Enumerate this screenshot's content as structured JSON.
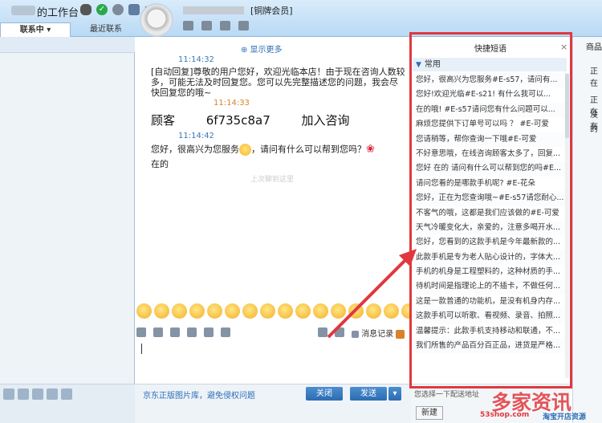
{
  "app": {
    "title": "的工作台",
    "unread_count": "2"
  },
  "tabs": [
    {
      "label": "联系中 ▾"
    },
    {
      "label": "最近联系"
    }
  ],
  "contact": {
    "member_badge": "[铜牌会员]"
  },
  "chat": {
    "show_more": "⊕ 显示更多",
    "messages": [
      {
        "time": "11:14:32",
        "text": "[自动回复]尊敬的用户您好，欢迎光临本店！由于现在咨询人数较多，可能无法及时回复您。您可以先完整描述您的问题，我会尽快回复您的哦~"
      },
      {
        "time": "11:14:33",
        "text": "顾客 6f735c8a7 加入咨询"
      },
      {
        "time": "11:14:42",
        "text_a": "您好，很高兴为您服务",
        "text_b": "，请问有什么可以帮到您吗？",
        "text_c": "在的"
      }
    ],
    "divider": "上次聊到这里",
    "record_label": "消息记录"
  },
  "footer": {
    "link": "京东正版图片库，避免侵权问题",
    "close_btn": "关闭",
    "send_btn": "发送",
    "send_arrow": "▾"
  },
  "quick_phrases": {
    "title": "快捷短语",
    "category": "常用",
    "items": [
      "您好，很高兴为您服务#E-s57，请问有...",
      "您好!欢迎光临#E-s21! 有什么我可以...",
      "在的哦! #E-s57请问您有什么问题可以...",
      "麻烦您提供下订单号可以吗 ？ #E-可爱",
      "您请稍等，帮你查询一下哦#E-可爱",
      "不好意思哦，在线咨询顾客太多了，回复...",
      "您好 在的 请问有什么可以帮到您的吗#E...",
      "请问您看的是哪款手机呢? #E-花朵",
      "您好，正在为您查询哦~#E-s57请您耐心...",
      "不客气的哦，这都是我们应该做的#E-可爱",
      "天气冷暖变化大，亲爱的，注意多喝开水...",
      "您好，您看到的这款手机是今年最新款的...",
      "此款手机是专为老人贴心设计的，字体大...",
      "手机的机身是工程塑料的，这种材质的手...",
      "待机时间是指理论上的不插卡，不做任何...",
      "这是一款普通的功能机，是没有机身内存...",
      "这款手机可以听歌、看视频、录音、拍照...",
      "温馨提示：此款手机支持移动和联通，不...",
      "我们所售的产品百分百正品，进货是严格..."
    ],
    "hint": "您选择一下配送地址",
    "new_btn": "新建"
  },
  "right_panel": {
    "tab": "商品",
    "lines": [
      "正在",
      "正在",
      "没有",
      "的"
    ]
  },
  "watermark": {
    "main": "多家资讯",
    "sub_left": "53shop.com",
    "sub_right": "淘宝开店资源"
  },
  "colors": {
    "accent": "#2d6eb5",
    "highlight_frame": "#e0383e"
  }
}
